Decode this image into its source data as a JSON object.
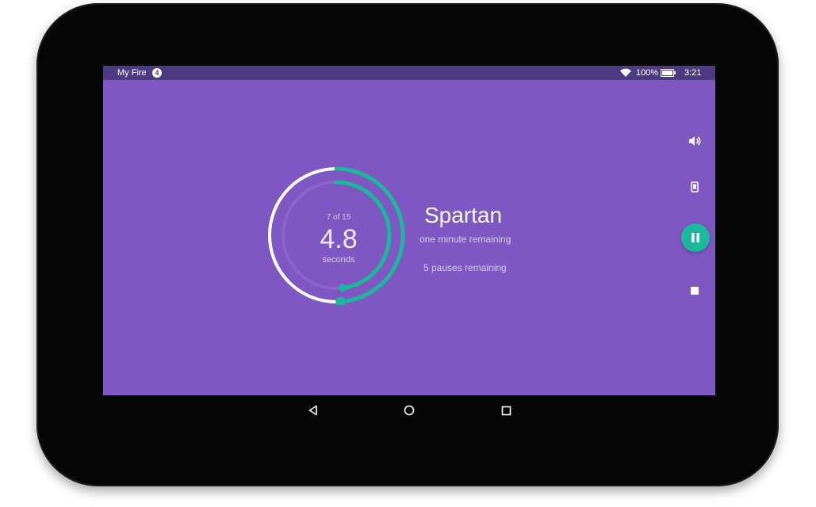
{
  "status_bar": {
    "title": "My Fire",
    "notification_count": "4",
    "battery_percent": "100%",
    "time": "3:21",
    "icons": [
      "wifi-icon",
      "battery-icon"
    ]
  },
  "workout": {
    "progress_label": "7 of 15",
    "timer_value": "4.8",
    "timer_unit": "seconds",
    "name": "Spartan",
    "time_remaining": "one minute remaining",
    "pauses_remaining": "5 pauses remaining",
    "overall_progress_fraction": 0.49,
    "exercise_progress_fraction": 0.48
  },
  "controls": [
    "volume-icon",
    "vibrate-icon",
    "pause-icon",
    "stop-icon"
  ],
  "nav_bar": [
    "back-icon",
    "home-icon",
    "recents-icon"
  ],
  "colors": {
    "background": "#7e57c2",
    "status_bar": "#4e3a82",
    "accent": "#1cb89e",
    "ring_track": "#ffffff"
  }
}
